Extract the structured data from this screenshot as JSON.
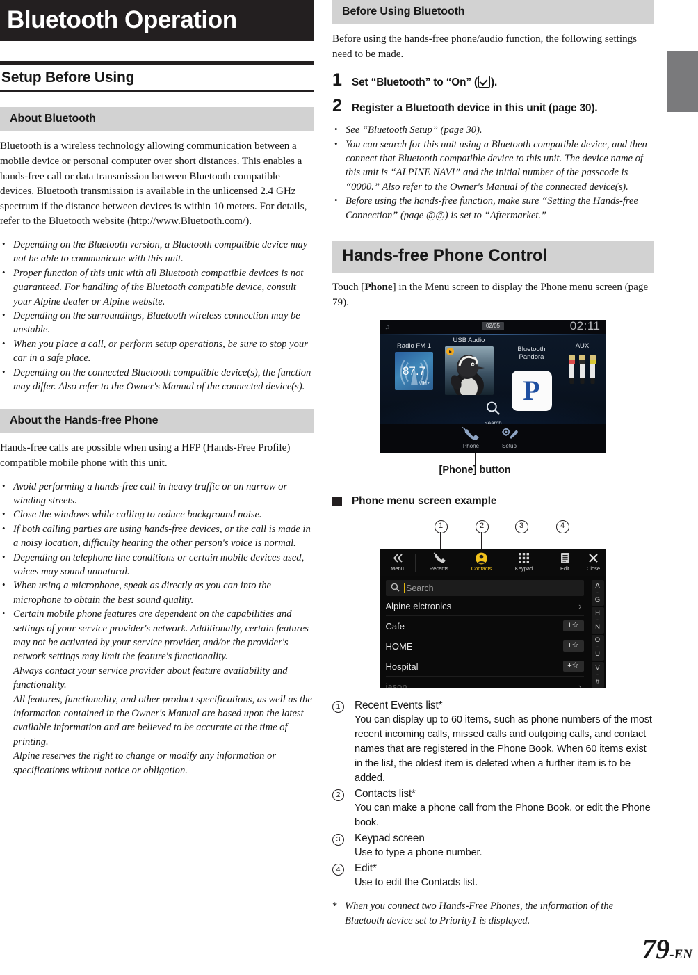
{
  "chapter": {
    "title": "Bluetooth Operation"
  },
  "left": {
    "section_title": "Setup Before Using",
    "about_bluetooth": {
      "heading": "About Bluetooth",
      "paragraph": "Bluetooth is a wireless technology allowing communication between a mobile device or personal computer over short distances. This enables a hands-free call or data transmission between Bluetooth compatible devices. Bluetooth transmission is available in the unlicensed 2.4 GHz spectrum if the distance between devices is within 10 meters. For details, refer to the Bluetooth website (http://www.Bluetooth.com/).",
      "notes": [
        "Depending on the Bluetooth version, a Bluetooth compatible device may not be able to communicate with this unit.",
        "Proper function of this unit with all Bluetooth compatible devices is not guaranteed. For handling of the Bluetooth compatible device, consult your Alpine dealer or Alpine website.",
        "Depending on the surroundings, Bluetooth wireless connection may be unstable.",
        "When you place a call, or perform setup operations, be sure to stop your car in a safe place.",
        "Depending on the connected Bluetooth compatible device(s), the function may differ. Also refer to the Owner's Manual of the connected device(s)."
      ]
    },
    "about_handsfree": {
      "heading": "About the Hands-free Phone",
      "paragraph": "Hands-free calls are possible when using a HFP (Hands-Free Profile) compatible mobile phone with this unit.",
      "notes": [
        "Avoid performing a hands-free call in heavy traffic or on narrow or winding streets.",
        "Close the windows while calling to reduce background noise.",
        "If both calling parties are using hands-free devices, or the call is made in a noisy location, difficulty hearing the other person's voice is normal.",
        "Depending on telephone line conditions or certain mobile devices used, voices may sound unnatural.",
        "When using a microphone, speak as directly as you can into the microphone to obtain the best sound quality."
      ],
      "long_note": [
        "Certain mobile phone features are dependent on the capabilities and settings of your service provider's network. Additionally, certain features may not be activated by your service provider, and/or the provider's network settings may limit the feature's functionality.",
        "Always contact your service provider about feature availability and functionality.",
        "All features, functionality, and other product specifications, as well as the information contained in the Owner's Manual are based upon the latest available information and are believed to be accurate at the time of printing.",
        "Alpine reserves the right to change or modify any information or specifications without notice or obligation."
      ]
    }
  },
  "right": {
    "before_using": {
      "heading": "Before Using Bluetooth",
      "paragraph": "Before using the hands-free phone/audio function, the following settings need to be made.",
      "steps": [
        {
          "num": "1",
          "pre": "Set “Bluetooth” to “On” (",
          "post": ")."
        },
        {
          "num": "2",
          "pre": "Register a Bluetooth device in this unit (page 30).",
          "post": ""
        }
      ],
      "notes": [
        "See “Bluetooth Setup” (page 30).",
        "You can search for this unit using a Bluetooth compatible device, and then connect that Bluetooth compatible device to this unit. The device name of this unit is “ALPINE NAVI” and the initial number of the passcode is “0000.” Also refer to the Owner's Manual of the connected device(s).",
        "Before using the hands-free function, make sure “Setting the Hands-free Connection” (page @@) is set to “Aftermarket.”"
      ]
    },
    "handsfree_control": {
      "heading": "Hands-free Phone Control",
      "paragraph_pre": "Touch [",
      "paragraph_bold": "Phone",
      "paragraph_post": "] in the Menu screen to display the Phone menu screen (page 79).",
      "figure_caption": "[Phone] button",
      "head_unit": {
        "status_track": "02/05",
        "status_clock": "02:11",
        "sources": [
          {
            "caption": "Radio FM 1",
            "value": "87.7",
            "unit": "MHz"
          },
          {
            "caption": "USB Audio"
          },
          {
            "caption": "Bluetooth\nPandora",
            "logo": "P"
          },
          {
            "caption": "AUX"
          }
        ],
        "search_label": "Search",
        "buttons": [
          {
            "label": "Phone",
            "icon": "phone-icon"
          },
          {
            "label": "Setup",
            "icon": "gear-wrench-icon"
          }
        ]
      }
    },
    "phone_menu": {
      "heading": "Phone menu screen example",
      "callout_numbers": [
        "1",
        "2",
        "3",
        "4"
      ],
      "toolbar": [
        {
          "label": "Menu",
          "icon": "double-chevron-left-icon"
        },
        {
          "label": "Recents",
          "icon": "recents-phone-icon"
        },
        {
          "label": "Contacts",
          "icon": "contact-person-icon"
        },
        {
          "label": "Keypad",
          "icon": "keypad-grid-icon"
        },
        {
          "label": "Edit",
          "icon": "edit-document-icon"
        },
        {
          "label": "Close",
          "icon": "close-x-icon"
        }
      ],
      "search_placeholder": "Search",
      "contacts": [
        {
          "name": "Alpine elctronics",
          "action": "chevron"
        },
        {
          "name": "Cafe",
          "action": "+☆"
        },
        {
          "name": "HOME",
          "action": "+☆"
        },
        {
          "name": "Hospital",
          "action": "+☆"
        },
        {
          "name": "jason",
          "action": "chevron"
        }
      ],
      "index_cells": [
        [
          "A",
          "G"
        ],
        [
          "H",
          "N"
        ],
        [
          "O",
          "U"
        ],
        [
          "V",
          "#"
        ]
      ],
      "accent_color": "#f2c21b"
    },
    "explanations": [
      {
        "num": "1",
        "title": "Recent Events list*",
        "desc": "You can display up to 60 items, such as phone numbers of the most recent incoming calls, missed calls and outgoing calls, and contact names that are registered in the Phone Book.  When 60 items exist in the list, the oldest item is deleted when a further item is to be added."
      },
      {
        "num": "2",
        "title": "Contacts list*",
        "desc": "You can make a phone call from the Phone Book, or edit the Phone book."
      },
      {
        "num": "3",
        "title": "Keypad screen",
        "desc": "Use to type a phone number."
      },
      {
        "num": "4",
        "title": "Edit*",
        "desc": "Use to edit the Contacts list."
      }
    ],
    "footnote": {
      "marker": "*",
      "text": "When you connect two Hands-Free Phones, the information of the Bluetooth device set to Priority1 is displayed."
    }
  },
  "footer": {
    "page_number": "79",
    "page_suffix": "-EN"
  }
}
